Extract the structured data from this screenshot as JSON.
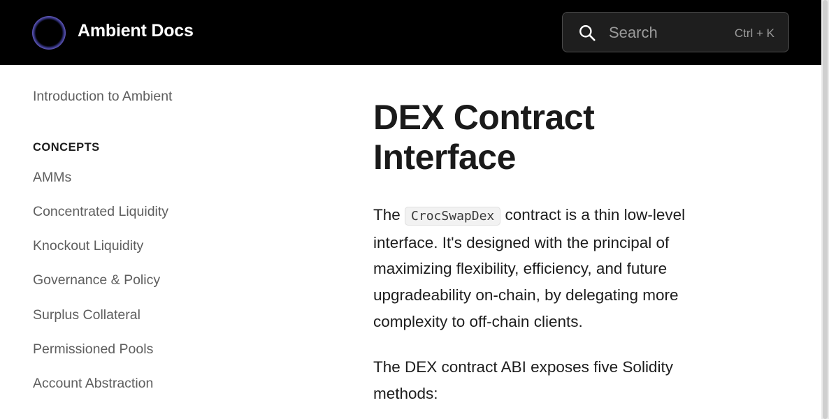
{
  "header": {
    "brand": "Ambient Docs",
    "search": {
      "placeholder": "Search",
      "shortcut": "Ctrl + K"
    }
  },
  "sidebar": {
    "intro": "Introduction to Ambient",
    "section_title": "CONCEPTS",
    "items": [
      "AMMs",
      "Concentrated Liquidity",
      "Knockout Liquidity",
      "Governance & Policy",
      "Surplus Collateral",
      "Permissioned Pools",
      "Account Abstraction"
    ]
  },
  "main": {
    "title": "DEX Contract Interface",
    "para1": {
      "prefix": "The",
      "code": "CrocSwapDex",
      "suffix": "contract is a thin low-level interface. It's designed with the principal of maximizing flexibility, efficiency, and future upgradeability on-chain, by delegating more complexity to off-chain clients."
    },
    "para2": "The DEX contract ABI exposes five Solidity methods:"
  },
  "colors": {
    "header_bg": "#000000",
    "accent": "#7b6fe0",
    "sidebar_text": "#5e5e5e",
    "body_text": "#1d1d1d"
  },
  "icons": [
    "logo-icon",
    "search-icon"
  ]
}
